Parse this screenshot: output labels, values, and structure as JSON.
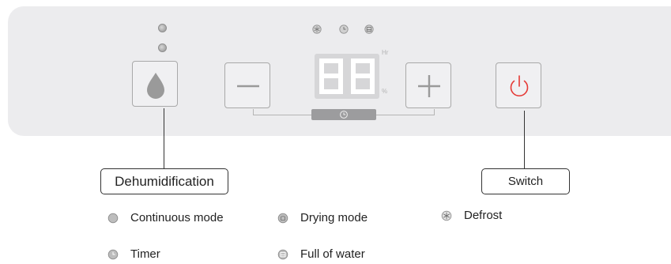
{
  "display": {
    "digits": "88",
    "unit_hours": "Hr",
    "unit_percent": "%"
  },
  "callouts": {
    "dehumidification": "Dehumidification",
    "switch": "Switch"
  },
  "legend": {
    "continuous_mode": "Continuous mode",
    "drying_mode": "Drying mode",
    "defrost": "Defrost",
    "timer": "Timer",
    "full_of_water": "Full of water"
  },
  "colors": {
    "panel": "#ececee",
    "button_border": "#a9a9a9",
    "icon_gray": "#9a9a9a",
    "power_red": "#e53935",
    "timer_bar": "#9c9c9e"
  },
  "icons": {
    "dehumidify_button": "water-drop-icon",
    "minus_button": "minus-icon",
    "plus_button": "plus-icon",
    "power_button": "power-icon",
    "continuous": "continuous-mode-icon",
    "drying": "drying-mode-icon",
    "defrost": "defrost-icon",
    "timer": "timer-icon",
    "full_water": "full-water-icon"
  }
}
